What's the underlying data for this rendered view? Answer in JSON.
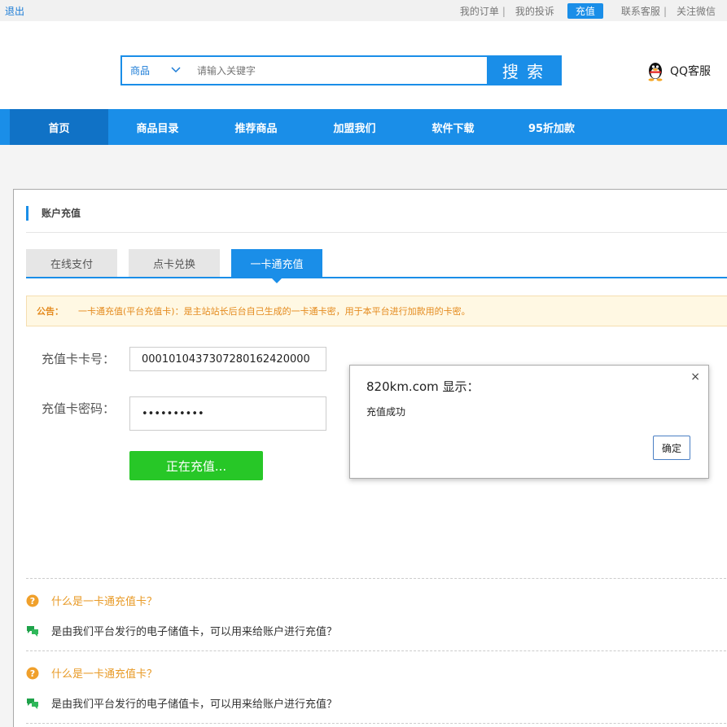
{
  "topbar": {
    "logout": "退出",
    "links": [
      "我的订单",
      "我的投诉",
      "充值",
      "联系客服",
      "关注微信"
    ],
    "separator": "|"
  },
  "search": {
    "category": "商品",
    "placeholder": "请输入关键字",
    "button": "搜 索"
  },
  "service": {
    "label": "QQ客服"
  },
  "nav": [
    "首页",
    "商品目录",
    "推荐商品",
    "加盟我们",
    "软件下载",
    "95折加款"
  ],
  "panel": {
    "title": "账户充值",
    "tabs": [
      "在线支付",
      "点卡兑换",
      "一卡通充值"
    ],
    "notice_label": "公告：",
    "notice_text": "一卡通充值(平台充值卡)：是主站站长后台自己生成的一卡通卡密，用于本平台进行加款用的卡密。",
    "card_no_label": "充值卡卡号：",
    "card_no_value": "0001010437307280162420000",
    "card_pw_label": "充值卡密码：",
    "card_pw_value": "••••••••••",
    "submit": "正在充值..."
  },
  "faq": [
    {
      "q": "什么是一卡通充值卡？",
      "a": "是由我们平台发行的电子储值卡，可以用来给账户进行充值？"
    },
    {
      "q": "什么是一卡通充值卡？",
      "a": "是由我们平台发行的电子储值卡，可以用来给账户进行充值？"
    }
  ],
  "dialog": {
    "title": "820km.com 显示：",
    "message": "充值成功",
    "ok": "确定",
    "close": "×"
  },
  "colors": {
    "brand": "#1a8ee8",
    "nav_active": "#1072c6",
    "submit": "#27c727",
    "notice": "#e48a1d"
  }
}
